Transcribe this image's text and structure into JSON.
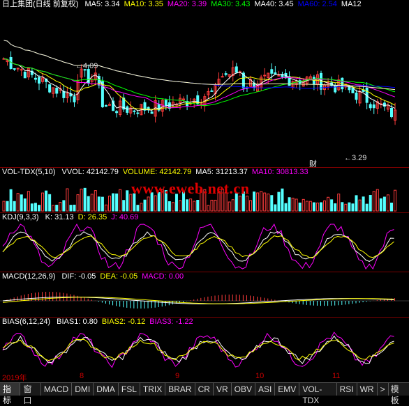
{
  "colors": {
    "bg": "#000000",
    "up": "#ff3c3c",
    "down": "#54ffff",
    "ma5": "#ffffff",
    "ma10": "#ffff00",
    "ma20": "#ff00ff",
    "ma30": "#00ff00",
    "ma40": "#ffffff",
    "ma60": "#0000ff",
    "ma120": "#ffffc0",
    "label_red": "#cc0000"
  },
  "price_panel": {
    "title": "日上集团(日线 前复权)",
    "indicators": [
      {
        "name": "MA5:",
        "value": "3.34",
        "color": "#ffffff"
      },
      {
        "name": "MA10:",
        "value": "3.35",
        "color": "#ffff00"
      },
      {
        "name": "MA20:",
        "value": "3.39",
        "color": "#ff00ff"
      },
      {
        "name": "MA30:",
        "value": "3.43",
        "color": "#00ff00"
      },
      {
        "name": "MA40:",
        "value": "3.45",
        "color": "#ffffff"
      },
      {
        "name": "MA60:",
        "value": "2.54",
        "color": "#0000ff"
      },
      {
        "name": "MA12",
        "value": "",
        "color": "#ffffff"
      }
    ],
    "high_label": "4.09",
    "low_label": "3.29",
    "news_marker": "财"
  },
  "vol_panel": {
    "title": "VOL-TDX(5,10)",
    "indicators": [
      {
        "name": "VVOL:",
        "value": "42142.79",
        "color": "#ffffff"
      },
      {
        "name": "VOLUME:",
        "value": "42142.79",
        "color": "#ffff00"
      },
      {
        "name": "MA5:",
        "value": "31213.37",
        "color": "#ffffff"
      },
      {
        "name": "MA10:",
        "value": "30813.33",
        "color": "#ff00ff"
      }
    ],
    "watermark": "www.eweb.net.cn"
  },
  "kdj_panel": {
    "title": "KDJ(9,3,3)",
    "indicators": [
      {
        "name": "K:",
        "value": "31.13",
        "color": "#ffffff"
      },
      {
        "name": "D:",
        "value": "26.35",
        "color": "#ffff00"
      },
      {
        "name": "J:",
        "value": "40.69",
        "color": "#ff00ff"
      }
    ]
  },
  "macd_panel": {
    "title": "MACD(12,26,9)",
    "indicators": [
      {
        "name": "DIF:",
        "value": "-0.05",
        "color": "#ffffff"
      },
      {
        "name": "DEA:",
        "value": "-0.05",
        "color": "#ffff00"
      },
      {
        "name": "MACD:",
        "value": "0.00",
        "color": "#ff00ff"
      }
    ]
  },
  "bias_panel": {
    "title": "BIAS(6,12,24)",
    "indicators": [
      {
        "name": "BIAS1:",
        "value": "0.80",
        "color": "#ffffff"
      },
      {
        "name": "BIAS2:",
        "value": "-0.12",
        "color": "#ffff00"
      },
      {
        "name": "BIAS3:",
        "value": "-1.22",
        "color": "#ff00ff"
      }
    ]
  },
  "x_axis": {
    "labels": [
      "2019年",
      "8",
      "9",
      "10",
      "11"
    ]
  },
  "tabs": {
    "items": [
      "指标",
      "窗口",
      "MACD",
      "DMI",
      "DMA",
      "FSL",
      "TRIX",
      "BRAR",
      "CR",
      "VR",
      "OBV",
      "ASI",
      "EMV",
      "VOL-TDX",
      "RSI",
      "WR"
    ],
    "more_arrow": ">",
    "last": "模板"
  }
}
